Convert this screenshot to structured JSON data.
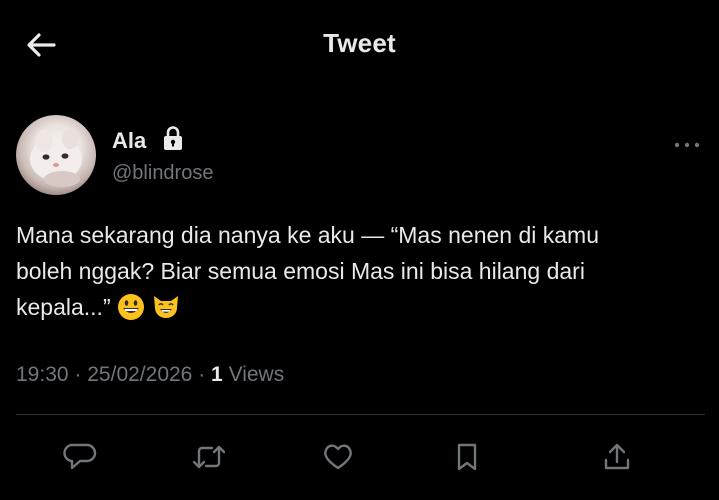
{
  "header": {
    "title": "Tweet",
    "back_icon": "arrow-left-icon"
  },
  "author": {
    "display_name": "Ala",
    "handle": "@blindrose",
    "protected_icon": "lock-icon",
    "more_icon": "more-horizontal-icon"
  },
  "tweet": {
    "line1": "Mana sekarang dia nanya ke aku — “Mas nenen di kamu",
    "line2": "boleh nggak? Biar semua emosi Mas ini bisa hilang dari",
    "line3": "kepala...”",
    "emojis": [
      "grinning-face-emoji",
      "smiling-cat-emoji"
    ]
  },
  "meta": {
    "time": "19:30",
    "date": "25/02/2026",
    "separator": "·",
    "views_count": "1",
    "views_label": "Views"
  },
  "actions": [
    {
      "icon": "reply-icon"
    },
    {
      "icon": "retweet-icon"
    },
    {
      "icon": "like-icon"
    },
    {
      "icon": "bookmark-icon"
    },
    {
      "icon": "share-icon"
    }
  ],
  "colors": {
    "background": "#000000",
    "text_primary": "#e7e9ea",
    "text_secondary": "#71767b",
    "divider": "#2f3336"
  }
}
